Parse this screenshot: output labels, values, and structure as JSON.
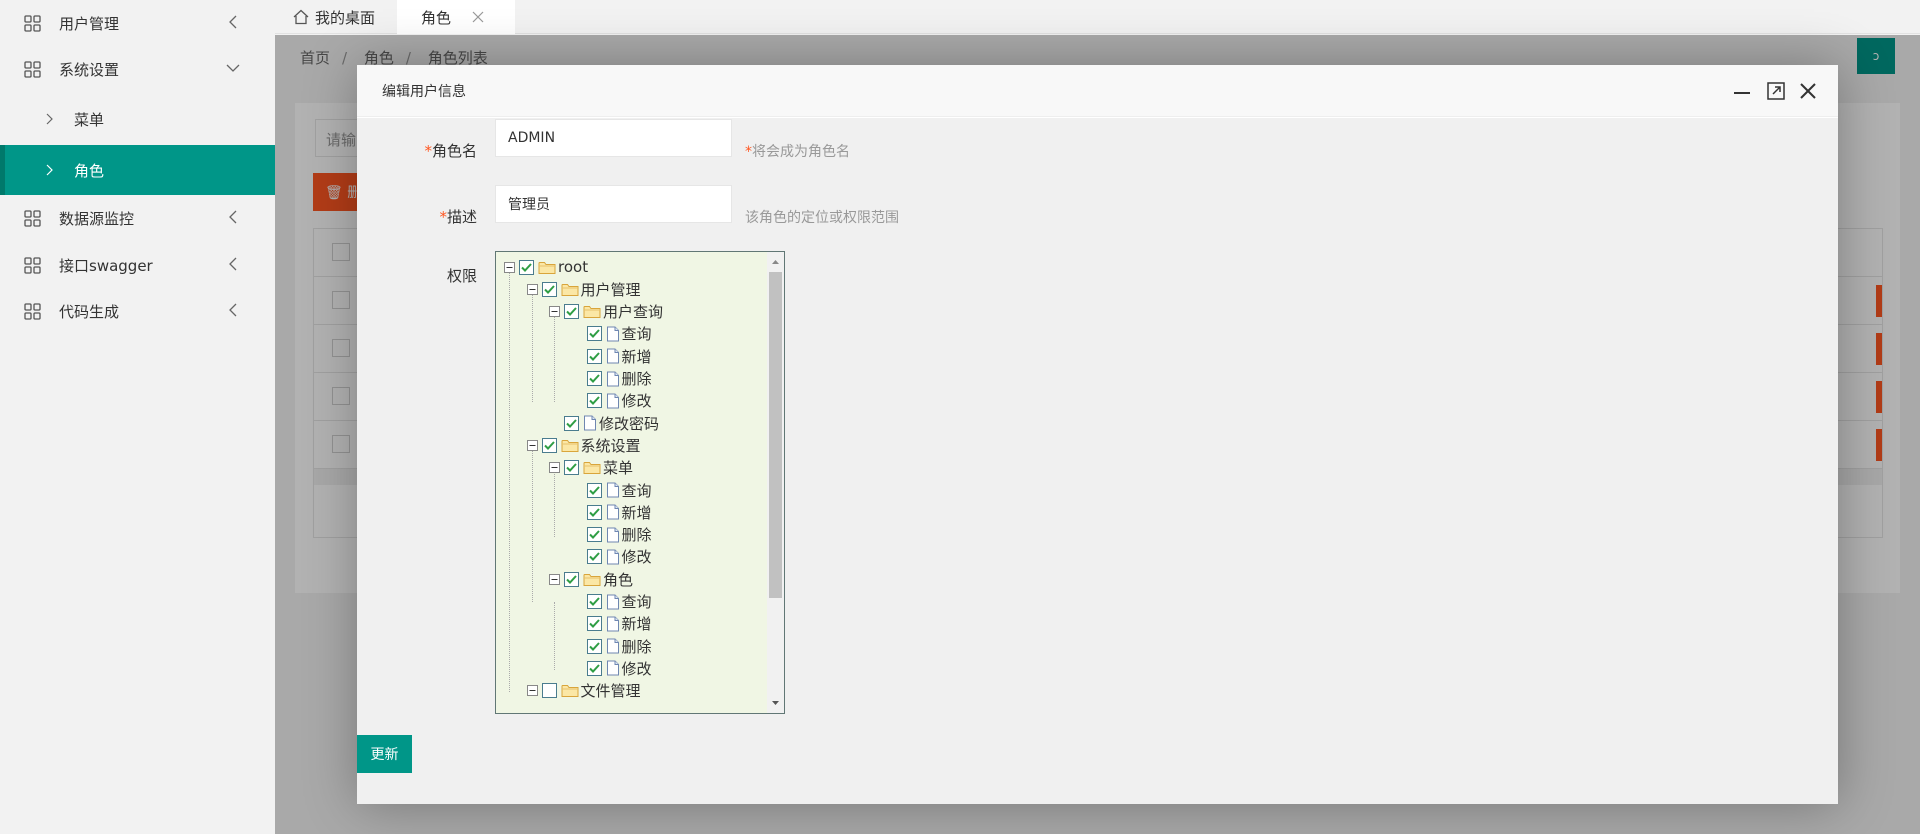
{
  "sidebar": {
    "items": [
      {
        "label": "用户管理",
        "chevron": "left"
      },
      {
        "label": "系统设置",
        "chevron": "down"
      },
      {
        "label": "菜单",
        "sub": true
      },
      {
        "label": "角色",
        "sub": true,
        "active": true
      },
      {
        "label": "数据源监控",
        "chevron": "left"
      },
      {
        "label": "接口swagger",
        "chevron": "left"
      },
      {
        "label": "代码生成",
        "chevron": "left"
      }
    ]
  },
  "tabs": [
    {
      "label": "我的桌面",
      "icon": "home-icon"
    },
    {
      "label": "角色",
      "active": true,
      "closable": true
    }
  ],
  "breadcrumb": [
    "首页",
    "角色",
    "角色列表"
  ],
  "background_page": {
    "search_placeholder": "请输",
    "delete_label": "删",
    "refresh_label": "ↄ"
  },
  "modal": {
    "title": "编辑用户信息",
    "fields": {
      "role_name": {
        "label": "角色名",
        "value": "ADMIN",
        "hint": "将会成为角色名"
      },
      "description": {
        "label": "描述",
        "value": "管理员",
        "hint": "该角色的定位或权限范围"
      },
      "permissions": {
        "label": "权限"
      }
    },
    "submit_label": "更新"
  },
  "tree": [
    {
      "text": "root",
      "level": 0,
      "type": "folder",
      "checked": true,
      "expander": "minus"
    },
    {
      "text": "用户管理",
      "level": 1,
      "type": "folder",
      "checked": true,
      "expander": "minus"
    },
    {
      "text": "用户查询",
      "level": 2,
      "type": "folder",
      "checked": true,
      "expander": "minus"
    },
    {
      "text": "查询",
      "level": 3,
      "type": "file",
      "checked": true
    },
    {
      "text": "新增",
      "level": 3,
      "type": "file",
      "checked": true
    },
    {
      "text": "删除",
      "level": 3,
      "type": "file",
      "checked": true
    },
    {
      "text": "修改",
      "level": 3,
      "type": "file",
      "checked": true
    },
    {
      "text": "修改密码",
      "level": 2,
      "type": "file",
      "checked": true
    },
    {
      "text": "系统设置",
      "level": 1,
      "type": "folder",
      "checked": true,
      "expander": "minus"
    },
    {
      "text": "菜单",
      "level": 2,
      "type": "folder",
      "checked": true,
      "expander": "minus"
    },
    {
      "text": "查询",
      "level": 3,
      "type": "file",
      "checked": true
    },
    {
      "text": "新增",
      "level": 3,
      "type": "file",
      "checked": true
    },
    {
      "text": "删除",
      "level": 3,
      "type": "file",
      "checked": true
    },
    {
      "text": "修改",
      "level": 3,
      "type": "file",
      "checked": true
    },
    {
      "text": "角色",
      "level": 2,
      "type": "folder",
      "checked": true,
      "expander": "minus"
    },
    {
      "text": "查询",
      "level": 3,
      "type": "file",
      "checked": true
    },
    {
      "text": "新增",
      "level": 3,
      "type": "file",
      "checked": true
    },
    {
      "text": "删除",
      "level": 3,
      "type": "file",
      "checked": true
    },
    {
      "text": "修改",
      "level": 3,
      "type": "file",
      "checked": true
    },
    {
      "text": "文件管理",
      "level": 1,
      "type": "folder",
      "checked": false,
      "expander": "minus"
    }
  ],
  "colors": {
    "accent": "#009688",
    "danger": "#ff5722",
    "tree_bg": "#f0f6e4",
    "required": "#ff5722"
  }
}
